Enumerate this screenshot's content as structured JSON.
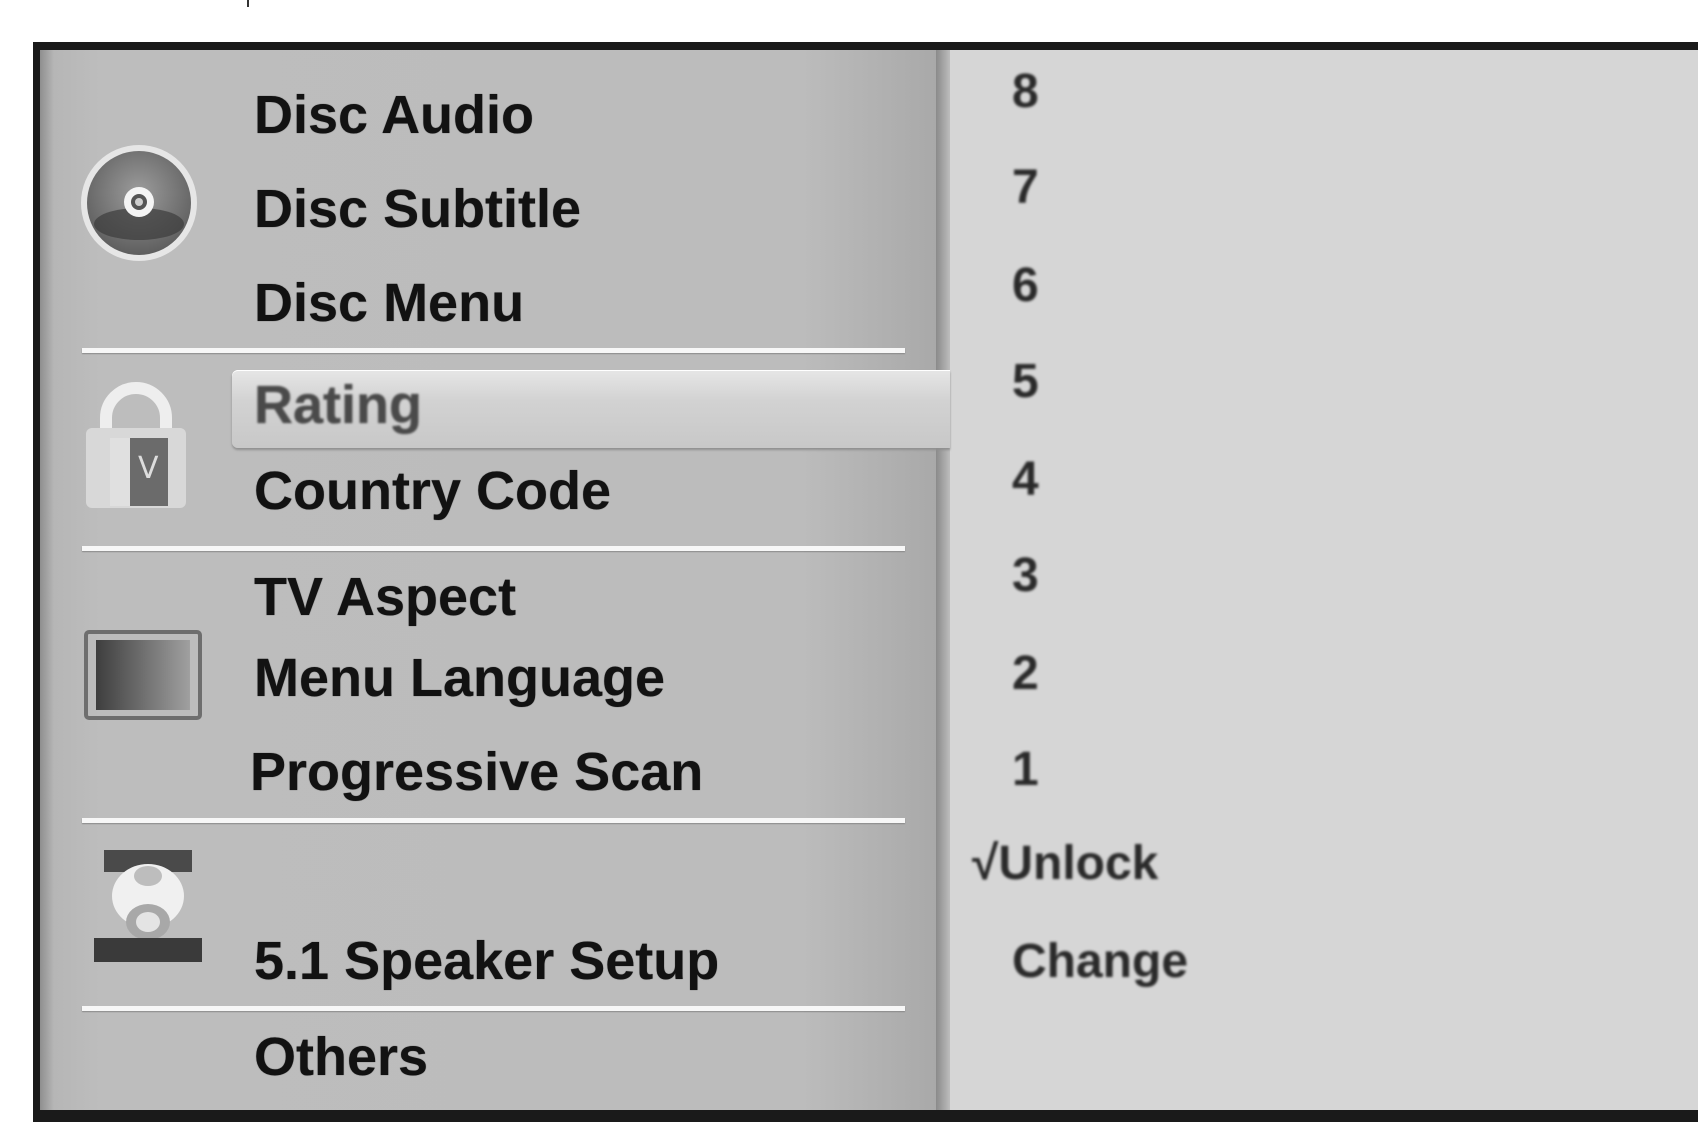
{
  "menu": {
    "sections": [
      {
        "icon": "disc-icon",
        "items": [
          {
            "label": "Disc Audio"
          },
          {
            "label": "Disc Subtitle"
          },
          {
            "label": "Disc Menu"
          }
        ]
      },
      {
        "icon": "lock-icon",
        "items": [
          {
            "label": "Rating",
            "selected": true
          },
          {
            "label": "Country Code"
          }
        ]
      },
      {
        "icon": "tv-icon",
        "items": [
          {
            "label": "TV Aspect"
          },
          {
            "label": "Menu Language"
          },
          {
            "label": "Progressive Scan"
          }
        ]
      },
      {
        "icon": "speaker-icon",
        "items": [
          {
            "label": "5.1 Speaker Setup"
          }
        ]
      },
      {
        "icon": "",
        "items": [
          {
            "label": "Others"
          }
        ]
      }
    ]
  },
  "rating_options": {
    "values": [
      "8",
      "7",
      "6",
      "5",
      "4",
      "3",
      "2",
      "1"
    ],
    "unlock": {
      "check": "√",
      "label": "Unlock",
      "checked": true
    },
    "change": "Change"
  }
}
